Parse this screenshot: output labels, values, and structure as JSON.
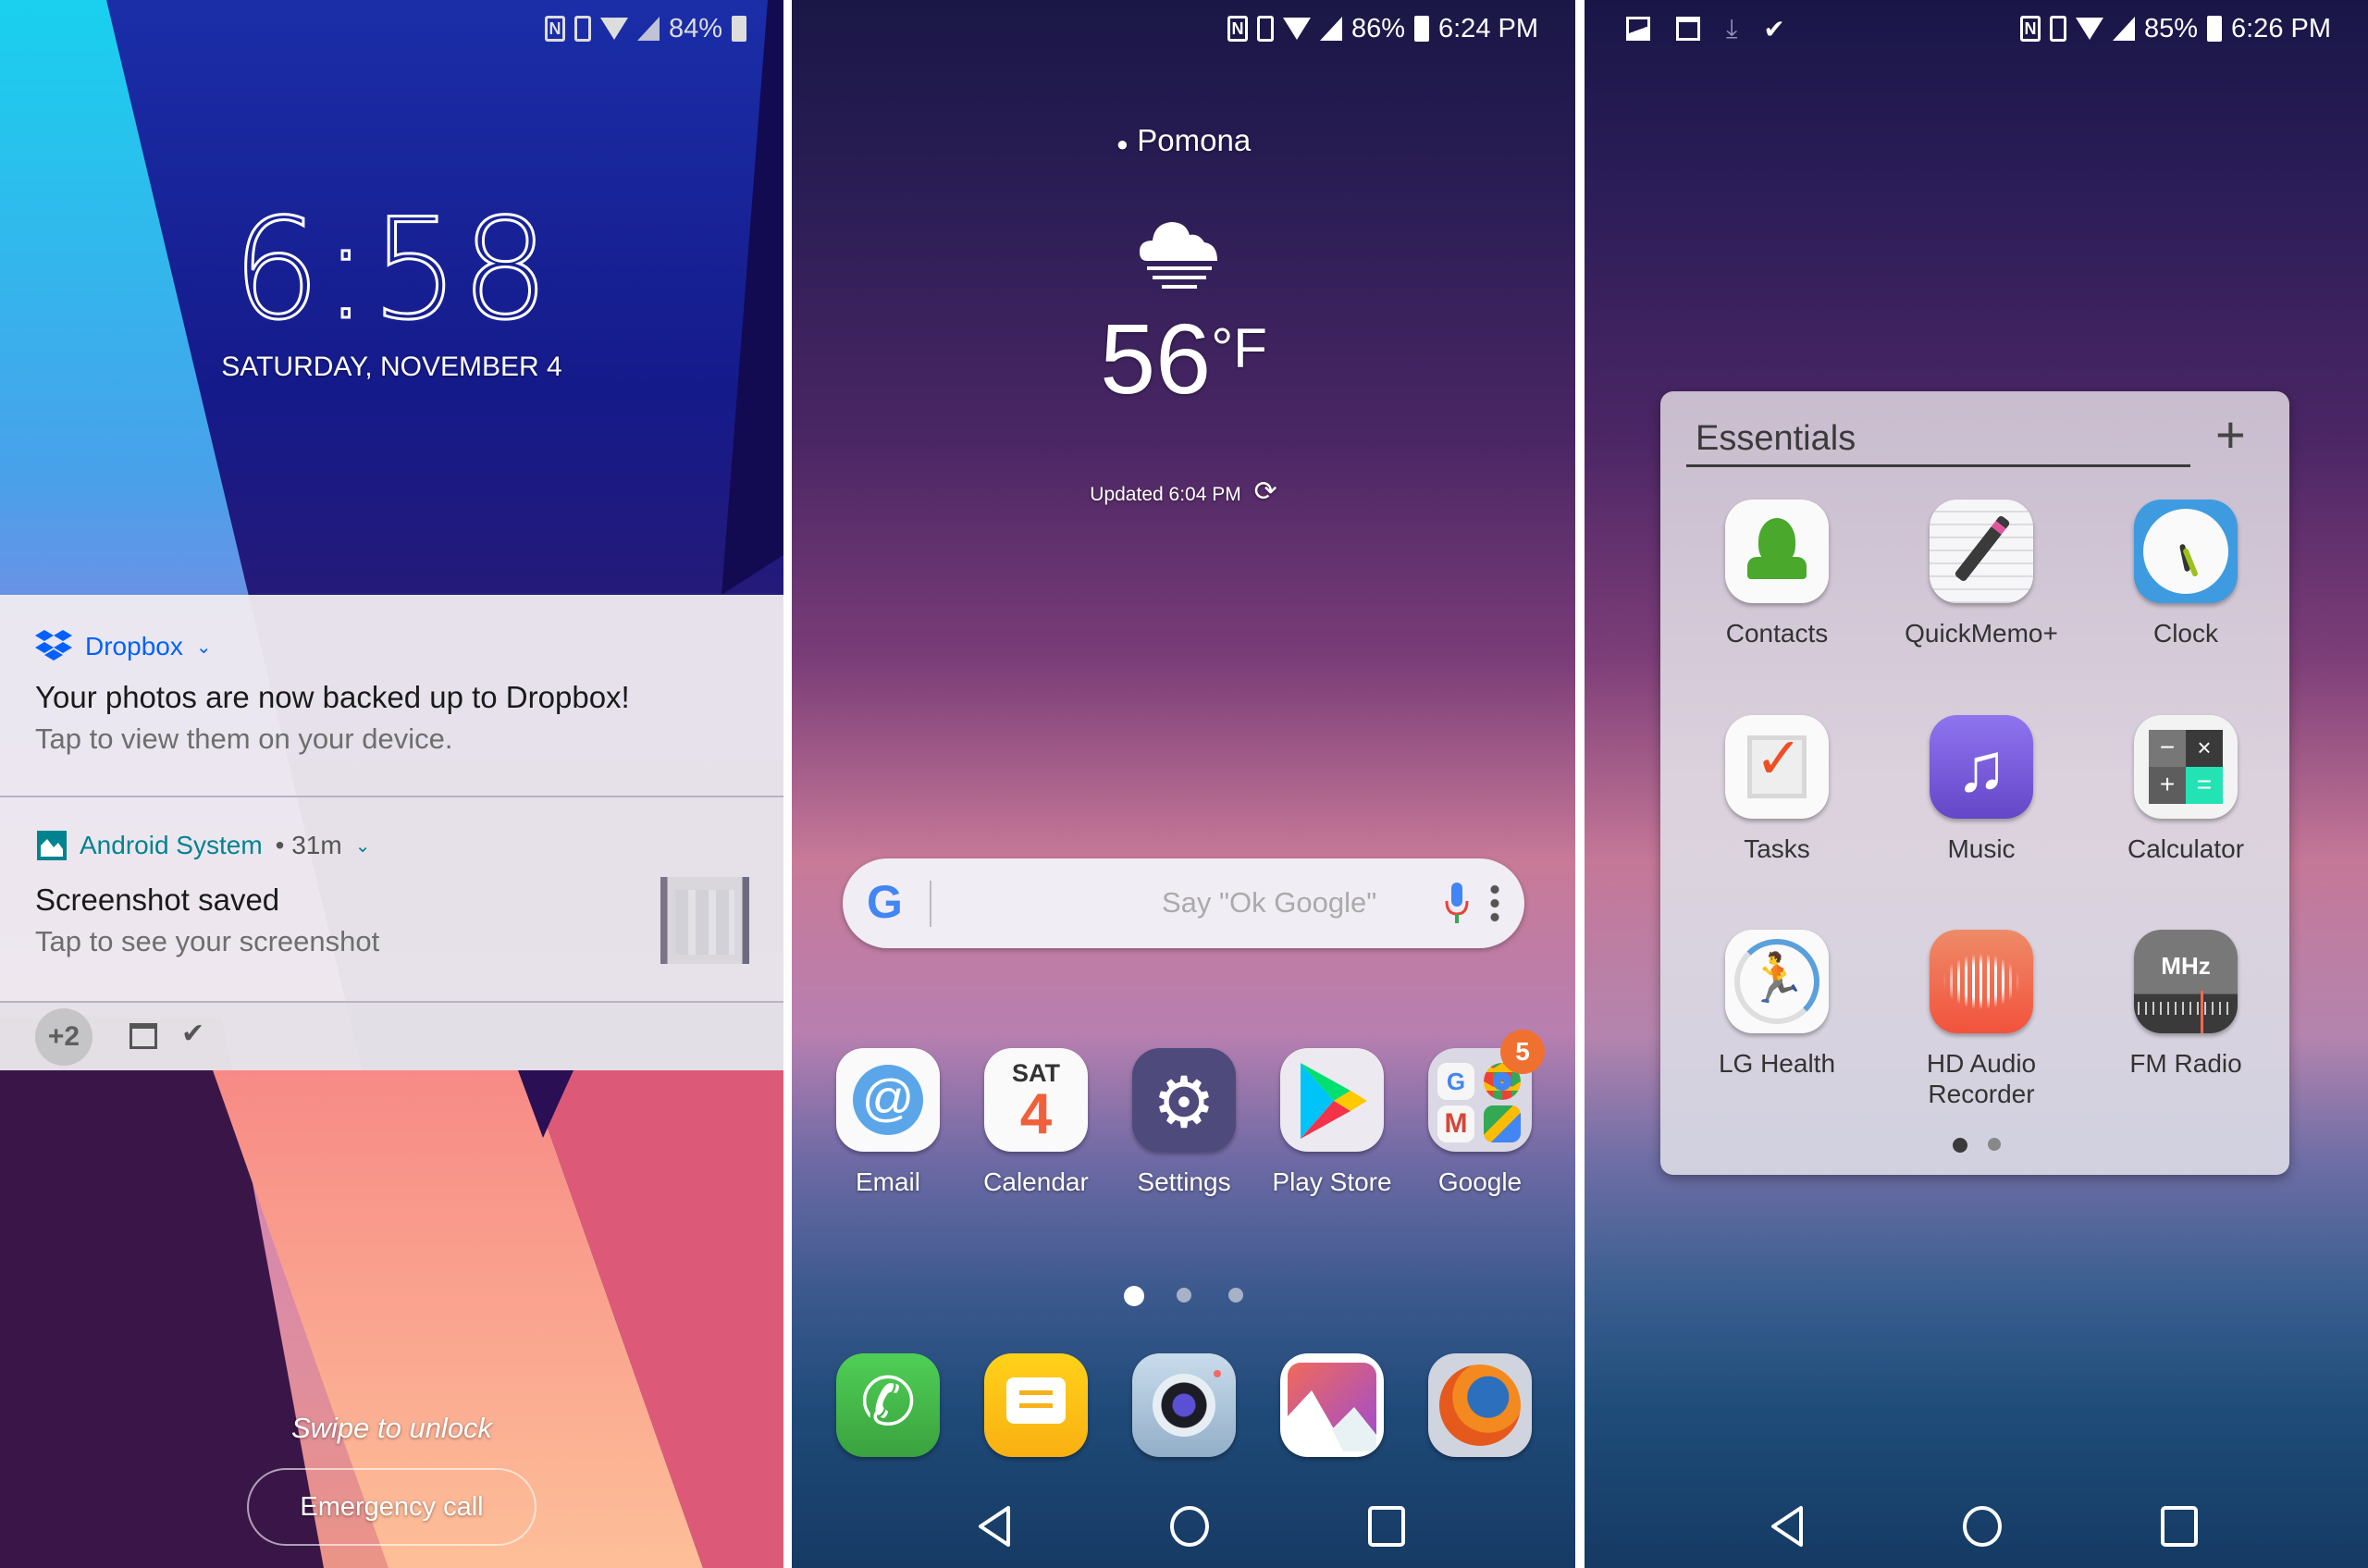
{
  "lockscreen": {
    "status_bar": {
      "icons": [
        "nfc-icon",
        "vibrate-icon",
        "wifi-icon",
        "signal-icon"
      ],
      "battery": "84%"
    },
    "clock": "6:58",
    "date": "SATURDAY, NOVEMBER 4",
    "notifications": [
      {
        "app": "Dropbox",
        "app_icon": "dropbox-icon",
        "app_color": "#0061fe",
        "title": "Your photos are now backed up to Dropbox!",
        "text": "Tap to view them on your device."
      },
      {
        "app": "Android System",
        "app_icon": "image-icon",
        "app_color": "#00838f",
        "meta": "• 31m",
        "title": "Screenshot saved",
        "text": "Tap to see your screenshot",
        "thumbnail": "screenshot-thumbnail"
      }
    ],
    "overflow": {
      "count_label": "+2",
      "icons": [
        "news-icon",
        "checklist-icon"
      ]
    },
    "swipe_hint": "Swipe to unlock",
    "emergency_button": "Emergency call"
  },
  "homescreen": {
    "status_bar": {
      "icons": [
        "nfc-icon",
        "vibrate-icon",
        "wifi-icon",
        "signal-icon"
      ],
      "battery": "86%",
      "time": "6:24 PM"
    },
    "weather": {
      "location": "Pomona",
      "condition_icon": "cloud-fog-icon",
      "temperature": "56",
      "unit": "°F",
      "updated": "Updated 6:04 PM"
    },
    "search": {
      "placeholder": "Say \"Ok Google\""
    },
    "apps": [
      {
        "label": "Email"
      },
      {
        "label": "Calendar",
        "day": "SAT",
        "date": "4"
      },
      {
        "label": "Settings"
      },
      {
        "label": "Play Store"
      },
      {
        "label": "Google",
        "badge": "5"
      }
    ],
    "pages": {
      "count": 3,
      "active": 1
    },
    "dock": [
      "Phone",
      "Messages",
      "Camera",
      "Gallery",
      "Firefox"
    ],
    "nav": [
      "back",
      "home",
      "recents"
    ]
  },
  "folderscreen": {
    "status_bar": {
      "notif_icons": [
        "image-icon",
        "news-icon",
        "download-icon",
        "checklist-icon"
      ],
      "icons": [
        "nfc-icon",
        "vibrate-icon",
        "wifi-icon",
        "signal-icon"
      ],
      "battery": "85%",
      "time": "6:26 PM"
    },
    "folder": {
      "name": "Essentials",
      "add_label": "+",
      "apps": [
        {
          "label": "Contacts"
        },
        {
          "label": "QuickMemo+"
        },
        {
          "label": "Clock"
        },
        {
          "label": "Tasks"
        },
        {
          "label": "Music"
        },
        {
          "label": "Calculator"
        },
        {
          "label": "LG Health"
        },
        {
          "label": "HD Audio Recorder"
        },
        {
          "label": "FM Radio",
          "text": "MHz"
        }
      ],
      "pages": {
        "count": 2,
        "active": 1
      }
    }
  }
}
